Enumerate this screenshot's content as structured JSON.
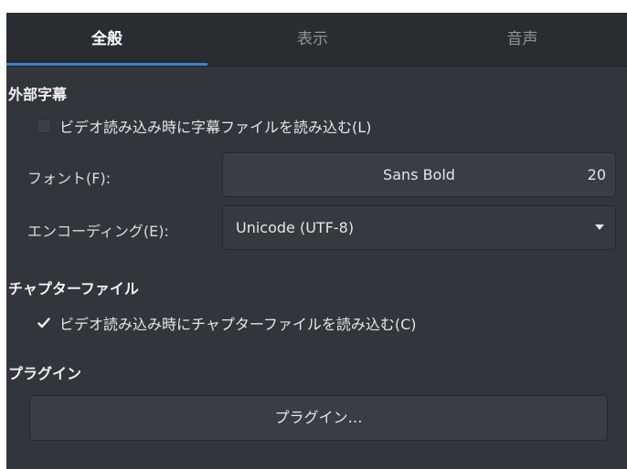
{
  "tabs": [
    {
      "label": "全般",
      "active": true
    },
    {
      "label": "表示",
      "active": false
    },
    {
      "label": "音声",
      "active": false
    }
  ],
  "subtitles": {
    "title": "外部字幕",
    "autoload_label": "ビデオ読み込み時に字幕ファイルを読み込む(L)",
    "autoload_checked": false,
    "font_label": "フォント(F):",
    "font_name": "Sans Bold",
    "font_size": "20",
    "encoding_label": "エンコーディング(E):",
    "encoding_value": "Unicode (UTF-8)"
  },
  "chapters": {
    "title": "チャプターファイル",
    "autoload_label": "ビデオ読み込み時にチャプターファイルを読み込む(C)",
    "autoload_checked": true
  },
  "plugins": {
    "title": "プラグイン",
    "button_label": "プラグイン…"
  },
  "colors": {
    "background": "#323539",
    "accent": "#3a84d0"
  },
  "icons": {
    "checkmark": "check-icon",
    "dropdown": "triangle-down-icon"
  }
}
